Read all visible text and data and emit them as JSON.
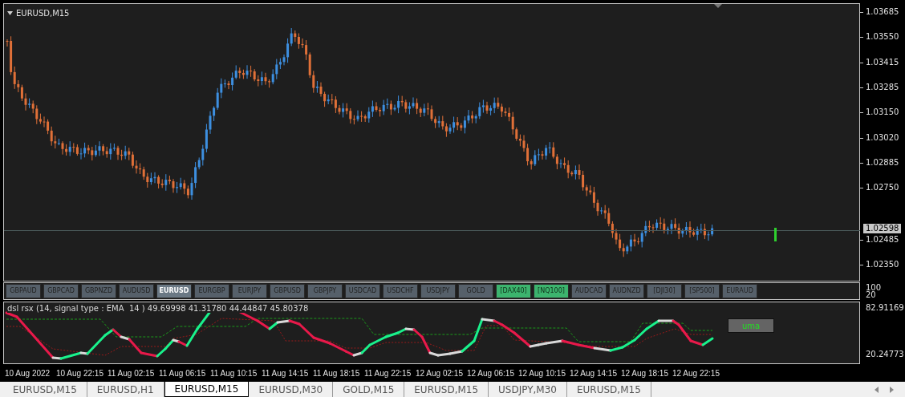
{
  "chart": {
    "title": "EURUSD,M15",
    "price_axis": [
      "1.03685",
      "1.03550",
      "1.03415",
      "1.03285",
      "1.03150",
      "1.03020",
      "1.02885",
      "1.02750",
      "1.02485",
      "1.02350"
    ],
    "current_price": "1.02598"
  },
  "symbol_buttons": [
    {
      "label": "GBPAUD",
      "selected": false,
      "highlighted": false
    },
    {
      "label": "GBPCAD",
      "selected": false,
      "highlighted": false
    },
    {
      "label": "GBPNZD",
      "selected": false,
      "highlighted": false
    },
    {
      "label": "AUDUSD",
      "selected": false,
      "highlighted": false
    },
    {
      "label": "EURUSD",
      "selected": true,
      "highlighted": false
    },
    {
      "label": "EURGBP",
      "selected": false,
      "highlighted": false
    },
    {
      "label": "EURJPY",
      "selected": false,
      "highlighted": false
    },
    {
      "label": "GBPUSD",
      "selected": false,
      "highlighted": false
    },
    {
      "label": "GBPJPY",
      "selected": false,
      "highlighted": false
    },
    {
      "label": "USDCAD",
      "selected": false,
      "highlighted": false
    },
    {
      "label": "USDCHF",
      "selected": false,
      "highlighted": false
    },
    {
      "label": "USDJPY",
      "selected": false,
      "highlighted": false
    },
    {
      "label": "GOLD",
      "selected": false,
      "highlighted": false
    },
    {
      "label": "[DAX40]",
      "selected": false,
      "highlighted": true
    },
    {
      "label": "[NQ100]",
      "selected": false,
      "highlighted": true
    },
    {
      "label": "AUDCAD",
      "selected": false,
      "highlighted": false
    },
    {
      "label": "AUDNZD",
      "selected": false,
      "highlighted": false
    },
    {
      "label": "[DJI30]",
      "selected": false,
      "highlighted": false
    },
    {
      "label": "[SP500]",
      "selected": false,
      "highlighted": false
    },
    {
      "label": "EURAUD",
      "selected": false,
      "highlighted": false
    }
  ],
  "button_axis": [
    "100",
    "20"
  ],
  "indicator": {
    "label": "dsl rsx (14, signal type : EMA  14 ) 49.69998 41.31780 44.44847 45.80378",
    "axis": [
      "82.91169",
      "20.24773"
    ],
    "button": "uma"
  },
  "time_axis": [
    "10 Aug 2022",
    "10 Aug 22:15",
    "11 Aug 02:15",
    "11 Aug 06:15",
    "11 Aug 10:15",
    "11 Aug 14:15",
    "11 Aug 18:15",
    "11 Aug 22:15",
    "12 Aug 02:15",
    "12 Aug 06:15",
    "12 Aug 10:15",
    "12 Aug 14:15",
    "12 Aug 18:15",
    "12 Aug 22:15"
  ],
  "tabs": [
    {
      "label": "EURUSD,M15",
      "selected": false
    },
    {
      "label": "EURUSD,H1",
      "selected": false
    },
    {
      "label": "EURUSD,M15",
      "selected": true
    },
    {
      "label": "EURUSD,M30",
      "selected": false
    },
    {
      "label": "GOLD,M15",
      "selected": false
    },
    {
      "label": "EURUSD,M15",
      "selected": false
    },
    {
      "label": "USDJPY,M30",
      "selected": false
    },
    {
      "label": "EURUSD,M15",
      "selected": false
    }
  ]
}
